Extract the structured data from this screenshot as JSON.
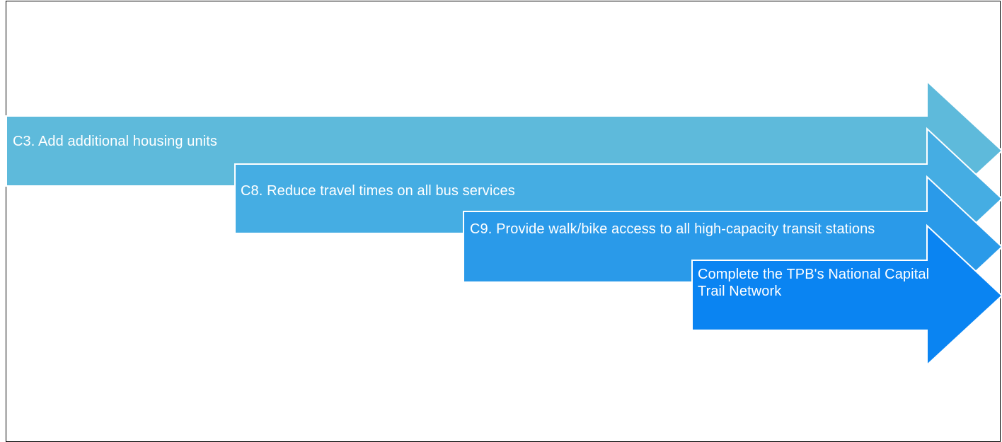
{
  "diagram": {
    "arrows": [
      {
        "id": "c3",
        "text": "C3. Add additional housing units",
        "color": "#5ebadb"
      },
      {
        "id": "c8",
        "text": "C8. Reduce travel times on all bus services",
        "color": "#45ade3"
      },
      {
        "id": "c9",
        "text": "C9. Provide walk/bike access to all high-capacity transit stations",
        "color": "#2a9ae9"
      },
      {
        "id": "trail",
        "text": "Complete the TPB's National Capital Trail Network",
        "color": "#0a84f2"
      }
    ],
    "outline_color": "#ffffff"
  }
}
